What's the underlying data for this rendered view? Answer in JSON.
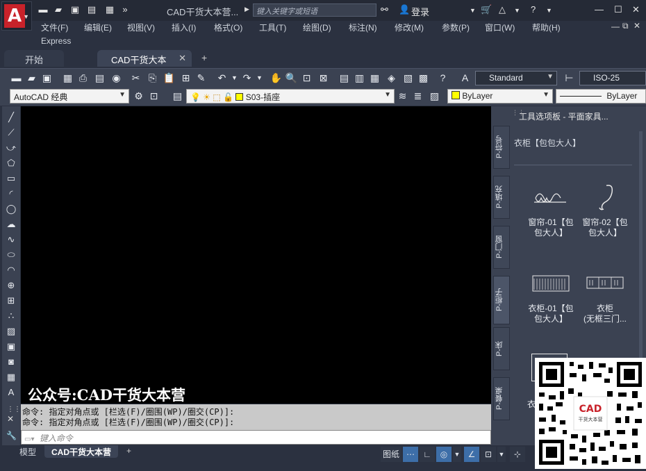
{
  "app": {
    "logo_letter": "A",
    "title": "CAD干货大本营...",
    "search_placeholder": "键入关键字或短语",
    "login": "登录"
  },
  "menu": [
    "文件(F)",
    "编辑(E)",
    "视图(V)",
    "插入(I)",
    "格式(O)",
    "工具(T)",
    "绘图(D)",
    "标注(N)",
    "修改(M)",
    "参数(P)",
    "窗口(W)",
    "帮助(H)"
  ],
  "menu_express": "Express",
  "tabs": [
    {
      "label": "开始"
    },
    {
      "label": "CAD干货大本营*"
    }
  ],
  "toolbar": {
    "text_style": "Standard",
    "dim_style": "ISO-25",
    "workspace": "AutoCAD 经典",
    "layer": "S03-插座",
    "color": "ByLayer",
    "linetype": "ByLayer"
  },
  "canvas": {
    "watermark": "公众号:CAD干货大本营"
  },
  "command": {
    "history": [
      "命令: 指定对角点或 [栏选(F)/圈围(WP)/圈交(CP)]:",
      "命令: 指定对角点或 [栏选(F)/圈围(WP)/圈交(CP)]:"
    ],
    "placeholder": "键入命令"
  },
  "layout_tabs": [
    "模型",
    "CAD干货大本营"
  ],
  "status": {
    "paper": "图纸"
  },
  "palette": {
    "title": "工具选项板 - 平面家具...",
    "tabs": [
      "P-符号",
      "P-填充",
      "P-门窗",
      "P-柜子",
      "P-床",
      "P-餐桌"
    ],
    "active_tab": 3,
    "section": "衣柜【包包大人】",
    "items": [
      {
        "line1": "窗帘-01【包",
        "line2": "包大人】"
      },
      {
        "line1": "窗帘-02【包",
        "line2": "包大人】"
      },
      {
        "line1": "衣柜-01【包",
        "line2": "包大人】"
      },
      {
        "line1": "衣柜",
        "line2": "(无框三门..."
      }
    ],
    "partial_label": "衣"
  },
  "qr": {
    "badge": "CAD",
    "badge_sub": "干货大本营"
  },
  "colors": {
    "accent_red": "#c8222a",
    "layer_yellow": "#ffff00",
    "canvas": "#000000"
  }
}
